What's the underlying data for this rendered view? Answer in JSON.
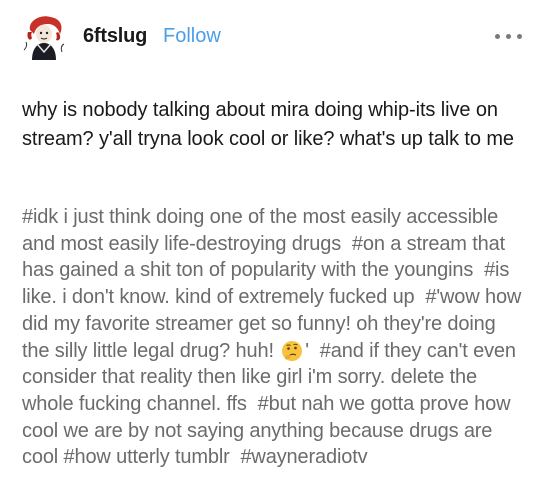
{
  "post": {
    "username": "6ftslug",
    "follow_label": "Follow",
    "body_text": "why is nobody talking about mira doing whip-its live on stream? y'all tryna look cool or like? what's up talk to me",
    "tags": [
      "#idk i just think doing one of the most easily accessible and most easily life-destroying drugs",
      "#on a stream that has gained a shit ton of popularity with the youngins",
      "#is like. i don't know. kind of extremely fucked up",
      "#'wow how did my favorite streamer get so funny! oh they're doing the silly little legal drug? huh!",
      "'",
      "#and if they can't even consider that reality then like girl i'm sorry. delete the whole fucking channel. ffs",
      "#but nah we gotta prove how cool we are by not saying anything because drugs are cool",
      "#how utterly tumblr",
      "#wayneradiotv"
    ]
  },
  "icons": {
    "avatar": "red-haired-character-avatar",
    "more": "more-options-icon",
    "emoji": "thinking-face-emoji"
  },
  "colors": {
    "username": "#1a1a1a",
    "follow": "#4a9fe8",
    "tags": "#6b6b6b",
    "more_dots": "#7a7a7a"
  }
}
